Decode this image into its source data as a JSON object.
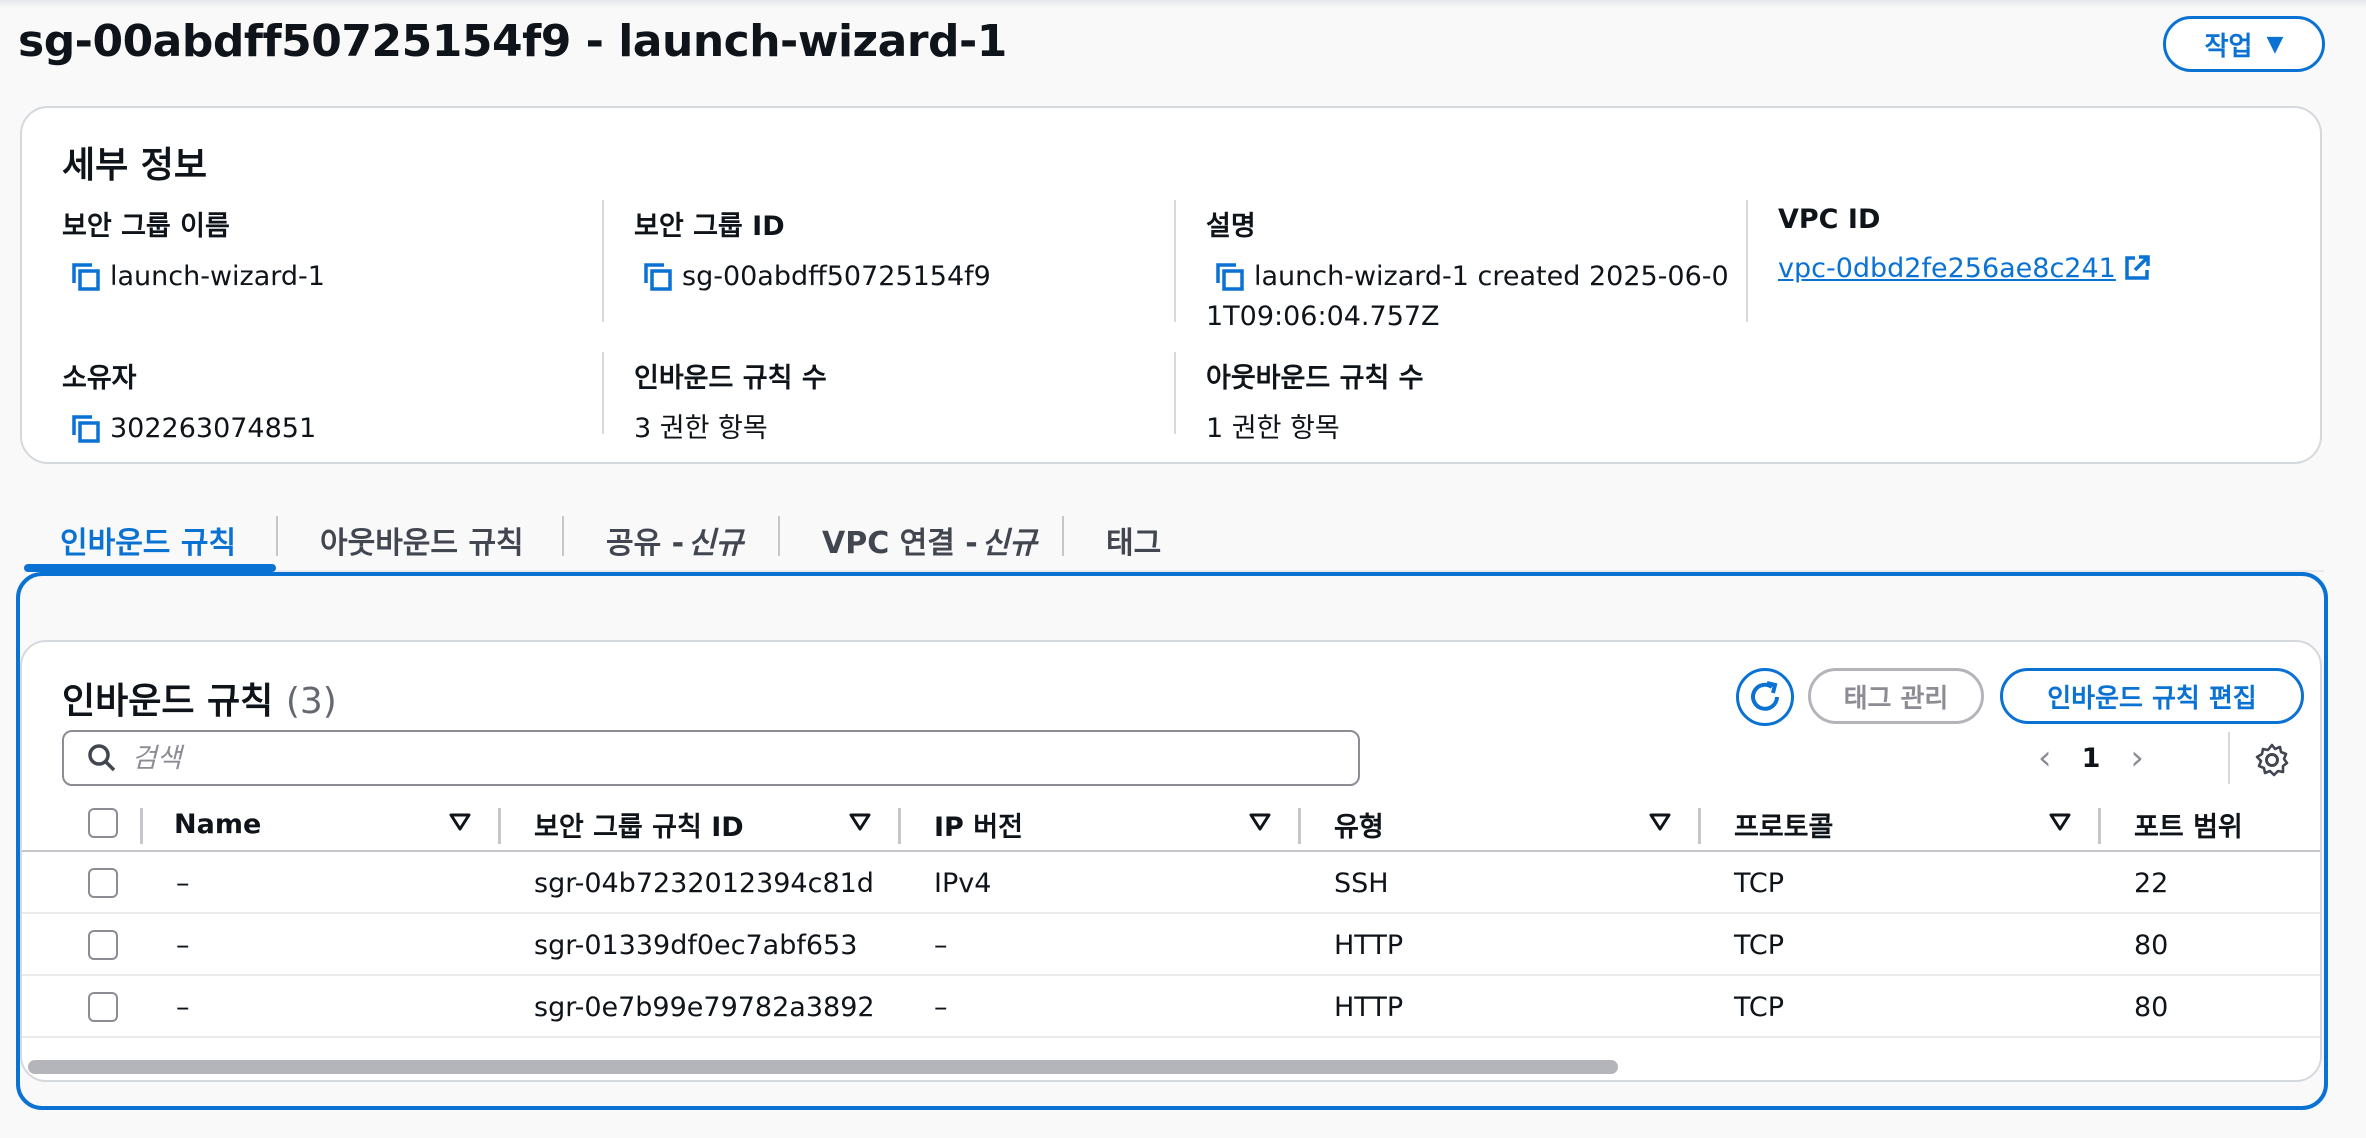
{
  "header": {
    "title": "sg-00abdff50725154f9 - launch-wizard-1",
    "actions_label": "작업"
  },
  "details": {
    "title": "세부 정보",
    "group_name": {
      "label": "보안 그룹 이름",
      "value": "launch-wizard-1"
    },
    "group_id": {
      "label": "보안 그룹 ID",
      "value": "sg-00abdff50725154f9"
    },
    "description": {
      "label": "설명",
      "value_line1": "launch-wizard-1 created 2025-06-0",
      "value_line2": "1T09:06:04.757Z"
    },
    "vpc_id": {
      "label": "VPC ID",
      "value": "vpc-0dbd2fe256ae8c241"
    },
    "owner": {
      "label": "소유자",
      "value": "302263074851"
    },
    "inbound_count": {
      "label": "인바운드 규칙 수",
      "value": "3 권한 항목"
    },
    "outbound_count": {
      "label": "아웃바운드 규칙 수",
      "value": "1 권한 항목"
    }
  },
  "tabs": [
    {
      "label": "인바운드 규칙",
      "suffix": "",
      "active": true
    },
    {
      "label": "아웃바운드 규칙",
      "suffix": "",
      "active": false
    },
    {
      "label": "공유 -",
      "suffix": "신규",
      "active": false
    },
    {
      "label": "VPC 연결 -",
      "suffix": "신규",
      "active": false
    },
    {
      "label": "태그",
      "suffix": "",
      "active": false
    }
  ],
  "rules": {
    "title": "인바운드 규칙",
    "count": "(3)",
    "tag_manage_label": "태그 관리",
    "edit_label": "인바운드 규칙 편집",
    "search_placeholder": "검색",
    "page": "1",
    "columns": [
      "Name",
      "보안 그룹 규칙 ID",
      "IP 버전",
      "유형",
      "프로토콜",
      "포트 범위"
    ],
    "rows": [
      [
        "–",
        "sgr-04b7232012394c81d",
        "IPv4",
        "SSH",
        "TCP",
        "22"
      ],
      [
        "–",
        "sgr-01339df0ec7abf653",
        "–",
        "HTTP",
        "TCP",
        "80"
      ],
      [
        "–",
        "sgr-0e7b99e79782a3892",
        "–",
        "HTTP",
        "TCP",
        "80"
      ]
    ]
  },
  "colors": {
    "accent": "#0972d3",
    "border": "#d5d8dd",
    "text": "#0f141a",
    "muted": "#656871"
  },
  "icons": [
    "copy-icon",
    "external-link-icon",
    "refresh-icon",
    "search-icon",
    "chevron-left-icon",
    "chevron-right-icon",
    "gear-icon",
    "sort-icon",
    "caret-down-icon"
  ]
}
